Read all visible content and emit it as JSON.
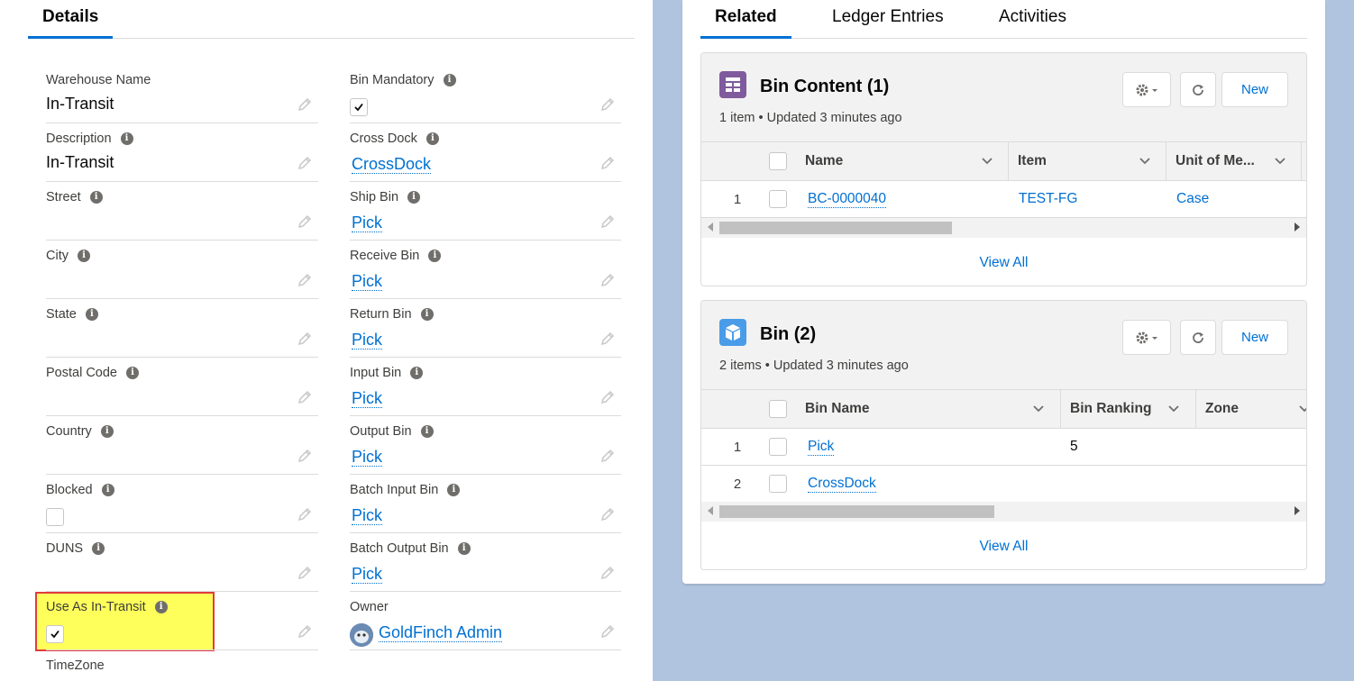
{
  "left_tabs": {
    "details": "Details"
  },
  "right_tabs": {
    "related": "Related",
    "ledger": "Ledger Entries",
    "activities": "Activities"
  },
  "fields_left": [
    {
      "label": "Warehouse Name",
      "value": "In-Transit",
      "info": false
    },
    {
      "label": "Description",
      "value": "In-Transit",
      "info": true
    },
    {
      "label": "Street",
      "value": "",
      "info": true
    },
    {
      "label": "City",
      "value": "",
      "info": true
    },
    {
      "label": "State",
      "value": "",
      "info": true
    },
    {
      "label": "Postal Code",
      "value": "",
      "info": true
    },
    {
      "label": "Country",
      "value": "",
      "info": true
    },
    {
      "label": "Blocked",
      "checked": false,
      "info": true
    },
    {
      "label": "DUNS",
      "value": "",
      "info": true
    },
    {
      "label": "Use As In-Transit",
      "checked": true,
      "info": true
    },
    {
      "label": "TimeZone",
      "value": "",
      "info": false
    }
  ],
  "fields_right": [
    {
      "label": "Bin Mandatory",
      "checked": true,
      "info": true
    },
    {
      "label": "Cross Dock",
      "link": "CrossDock",
      "info": true
    },
    {
      "label": "Ship Bin",
      "link": "Pick",
      "info": true
    },
    {
      "label": "Receive Bin",
      "link": "Pick",
      "info": true
    },
    {
      "label": "Return Bin",
      "link": "Pick",
      "info": true
    },
    {
      "label": "Input Bin",
      "link": "Pick",
      "info": true
    },
    {
      "label": "Output Bin",
      "link": "Pick",
      "info": true
    },
    {
      "label": "Batch Input Bin",
      "link": "Pick",
      "info": true
    },
    {
      "label": "Batch Output Bin",
      "link": "Pick",
      "info": true
    },
    {
      "label": "Owner",
      "link": "GoldFinch Admin",
      "info": false
    }
  ],
  "info_glyph": "i",
  "bin_content": {
    "title": "Bin Content (1)",
    "subtitle": "1 item • Updated 3 minutes ago",
    "new_label": "New",
    "columns": [
      "Name",
      "Item",
      "Unit of Me..."
    ],
    "rows": [
      {
        "num": "1",
        "name": "BC-0000040",
        "item": "TEST-FG",
        "uom": "Case"
      }
    ],
    "view_all": "View All",
    "icon_color": "#7f5a9c"
  },
  "bin": {
    "title": "Bin (2)",
    "subtitle": "2 items • Updated 3 minutes ago",
    "new_label": "New",
    "columns": [
      "Bin Name",
      "Bin Ranking",
      "Zone"
    ],
    "rows": [
      {
        "num": "1",
        "name": "Pick",
        "ranking": "5"
      },
      {
        "num": "2",
        "name": "CrossDock",
        "ranking": ""
      }
    ],
    "view_all": "View All",
    "icon_color": "#4a9ce8"
  },
  "colors": {
    "accent": "#0070d2",
    "highlight": "#ffff5c",
    "highlight_border": "#e03c3c"
  }
}
